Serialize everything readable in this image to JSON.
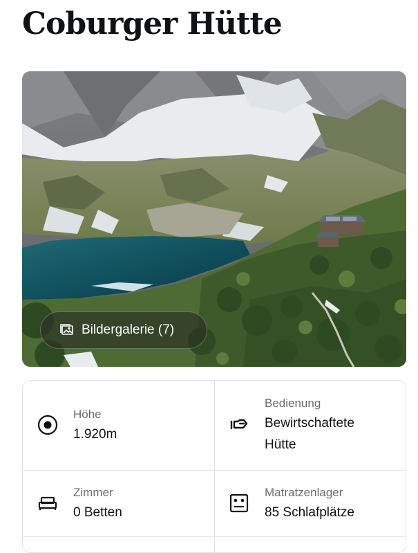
{
  "page": {
    "title": "Coburger Hütte"
  },
  "photo": {
    "gallery_button_label": "Bildergalerie (7)"
  },
  "facts": [
    {
      "icon": "altitude-dot-icon",
      "label": "Höhe",
      "value": "1.920m"
    },
    {
      "icon": "service-hand-icon",
      "label": "Bedienung",
      "value_line1": "Bewirtschaftete",
      "value_line2": "Hütte"
    },
    {
      "icon": "bed-icon",
      "label": "Zimmer",
      "value": "0 Betten"
    },
    {
      "icon": "mattress-icon",
      "label": "Matratzenlager",
      "value": "85 Schlafplätze"
    }
  ]
}
